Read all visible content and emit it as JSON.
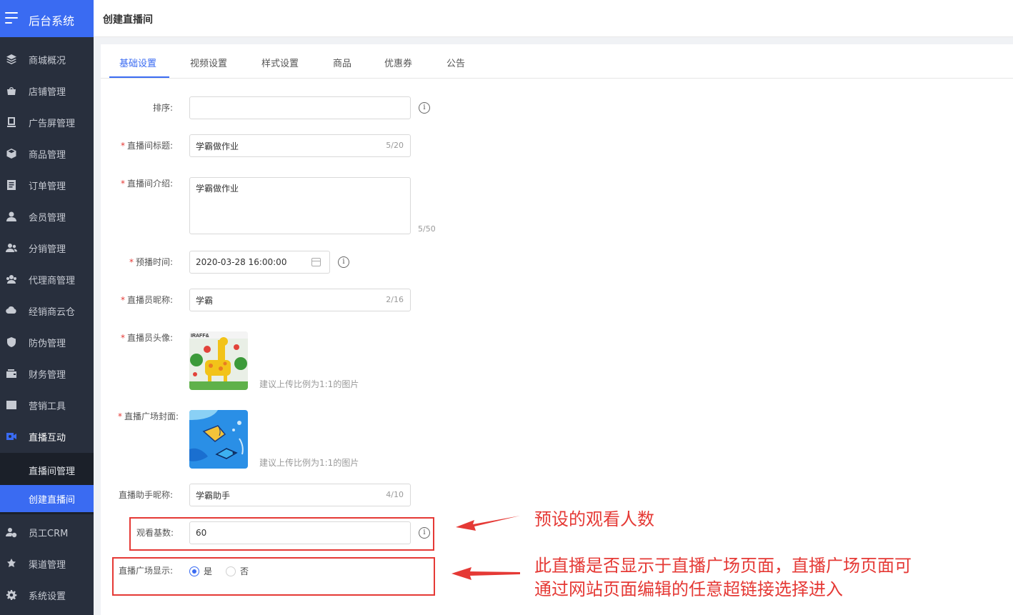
{
  "sidebar": {
    "brand": "后台系统",
    "items": [
      {
        "label": "商城概况",
        "icon": "layers-icon"
      },
      {
        "label": "店铺管理",
        "icon": "shop-icon"
      },
      {
        "label": "广告屏管理",
        "icon": "screen-icon"
      },
      {
        "label": "商品管理",
        "icon": "box-icon"
      },
      {
        "label": "订单管理",
        "icon": "order-icon"
      },
      {
        "label": "会员管理",
        "icon": "user-icon"
      },
      {
        "label": "分销管理",
        "icon": "distribution-icon"
      },
      {
        "label": "代理商管理",
        "icon": "agent-icon"
      },
      {
        "label": "经销商云仓",
        "icon": "warehouse-icon"
      },
      {
        "label": "防伪管理",
        "icon": "shield-icon"
      },
      {
        "label": "财务管理",
        "icon": "wallet-icon"
      },
      {
        "label": "营销工具",
        "icon": "chart-icon"
      },
      {
        "label": "直播互动",
        "icon": "video-icon"
      },
      {
        "label": "员工CRM",
        "icon": "staff-icon"
      },
      {
        "label": "渠道管理",
        "icon": "channel-icon"
      },
      {
        "label": "系统设置",
        "icon": "gear-icon"
      }
    ],
    "submenu": [
      "直播间管理",
      "创建直播间"
    ]
  },
  "header": {
    "breadcrumb": "创建直播间"
  },
  "tabs": [
    "基础设置",
    "视频设置",
    "样式设置",
    "商品",
    "优惠券",
    "公告"
  ],
  "form": {
    "sort": {
      "label": "排序:",
      "value": ""
    },
    "title": {
      "label": "直播间标题:",
      "value": "学霸做作业",
      "count": "5/20"
    },
    "intro": {
      "label": "直播间介绍:",
      "value": "学霸做作业",
      "count": "5/50"
    },
    "time": {
      "label": "预播时间:",
      "value": "2020-03-28 16:00:00"
    },
    "anchor_name": {
      "label": "直播员昵称:",
      "value": "学霸",
      "count": "2/16"
    },
    "avatar": {
      "label": "直播员头像:",
      "hint": "建议上传比例为1:1的图片"
    },
    "cover": {
      "label": "直播广场封面:",
      "hint": "建议上传比例为1:1的图片"
    },
    "assistant": {
      "label": "直播助手昵称:",
      "value": "学霸助手",
      "count": "4/10"
    },
    "base_views": {
      "label": "观看基数:",
      "value": "60"
    },
    "square_display": {
      "label": "直播广场显示:",
      "yes": "是",
      "no": "否",
      "selected": "是"
    }
  },
  "annotations": {
    "views_note": "预设的观看人数",
    "square_note_line1": "此直播是否显示于直播广场页面，直播广场页面可",
    "square_note_line2": "通过网站页面编辑的任意超链接选择进入",
    "color": "#e53935"
  }
}
